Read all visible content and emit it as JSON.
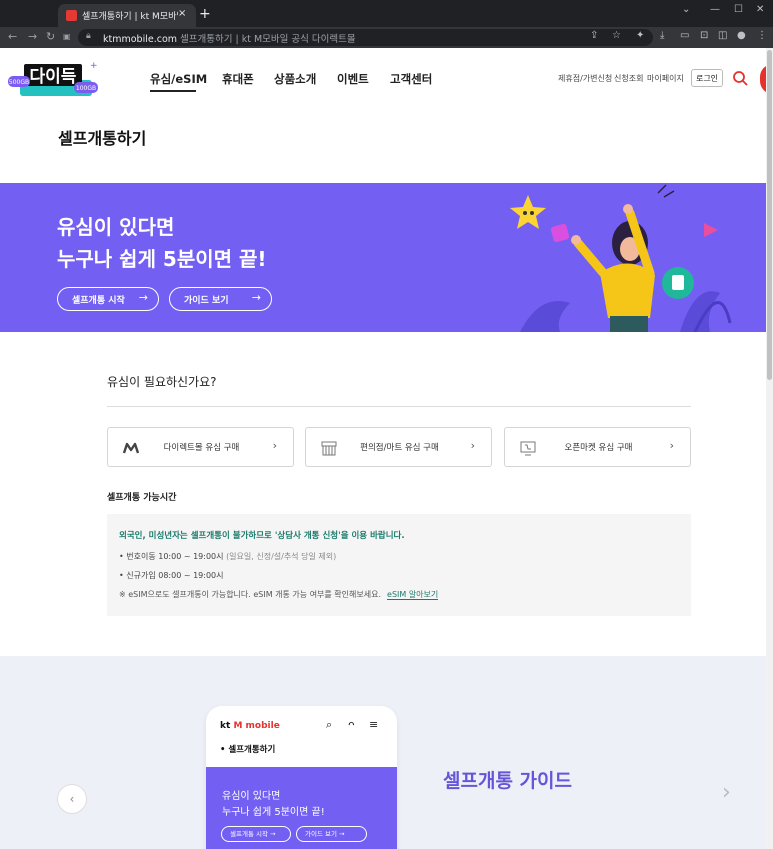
{
  "browser": {
    "tab_title": "셀프개통하기 | kt M모바일",
    "tab_close": "×",
    "new_tab": "+",
    "url_domain": "ktmmobile.com",
    "url_title": "셀프개통하기 | kt M모바일 공식 다이렉트몰"
  },
  "header": {
    "logo_text": "다이득",
    "logo_badge_left": "500GB",
    "logo_badge_right": "100GB",
    "gnb": [
      "유심/eSIM",
      "휴대폰",
      "상품소개",
      "이벤트",
      "고객센터"
    ],
    "util_links": [
      "제휴점/가변신청",
      "신청조회",
      "마이페이지"
    ],
    "login": "로그인"
  },
  "page_title": "셀프개통하기",
  "hero": {
    "line1": "유심이 있다면",
    "line2": "누구나 쉽게 5분이면 끝!",
    "btn_start": "셀프개통 시작",
    "btn_guide": "가이드 보기",
    "arrow": "→"
  },
  "usim": {
    "question": "유심이 필요하신가요?",
    "cards": [
      {
        "label": "다이렉트몰 유심 구매"
      },
      {
        "label": "편의점/마트 유심 구매"
      },
      {
        "label": "오픈마켓 유심 구매"
      }
    ],
    "chevron": "›"
  },
  "hours": {
    "title": "셀프개통 가능시간",
    "notice": "외국인, 미성년자는 셀프개통이 불가하므로 '상담사 개통 신청'을 이용 바랍니다.",
    "lines": [
      {
        "text": "번호이동 10:00 ~ 19:00시",
        "note": "(일요일, 신정/설/추석 당일 제외)"
      },
      {
        "text": "신규가입 08:00 ~ 19:00시",
        "note": ""
      }
    ],
    "esim_note": "※ eSIM으로도 셀프개통이 가능합니다. eSIM 개통 가능 여부를 확인해보세요.",
    "esim_link": "eSIM 알아보기"
  },
  "guide": {
    "phone_logo_kt": "kt",
    "phone_logo_m": "M mobile",
    "phone_crumb": "• 셀프개통하기",
    "phone_line1": "유심이 있다면",
    "phone_line2": "누구나 쉽게 5분이면 끝!",
    "phone_btn_start": "셀프개통 시작",
    "phone_btn_guide": "가이드 보기",
    "title": "셀프개통 가이드",
    "prev": "‹",
    "next": "›"
  },
  "colors": {
    "hero_bg": "#7360f2",
    "brand_red": "#e5322d",
    "notice_green": "#1a7a6b",
    "guide_bg": "#eef0f7"
  }
}
